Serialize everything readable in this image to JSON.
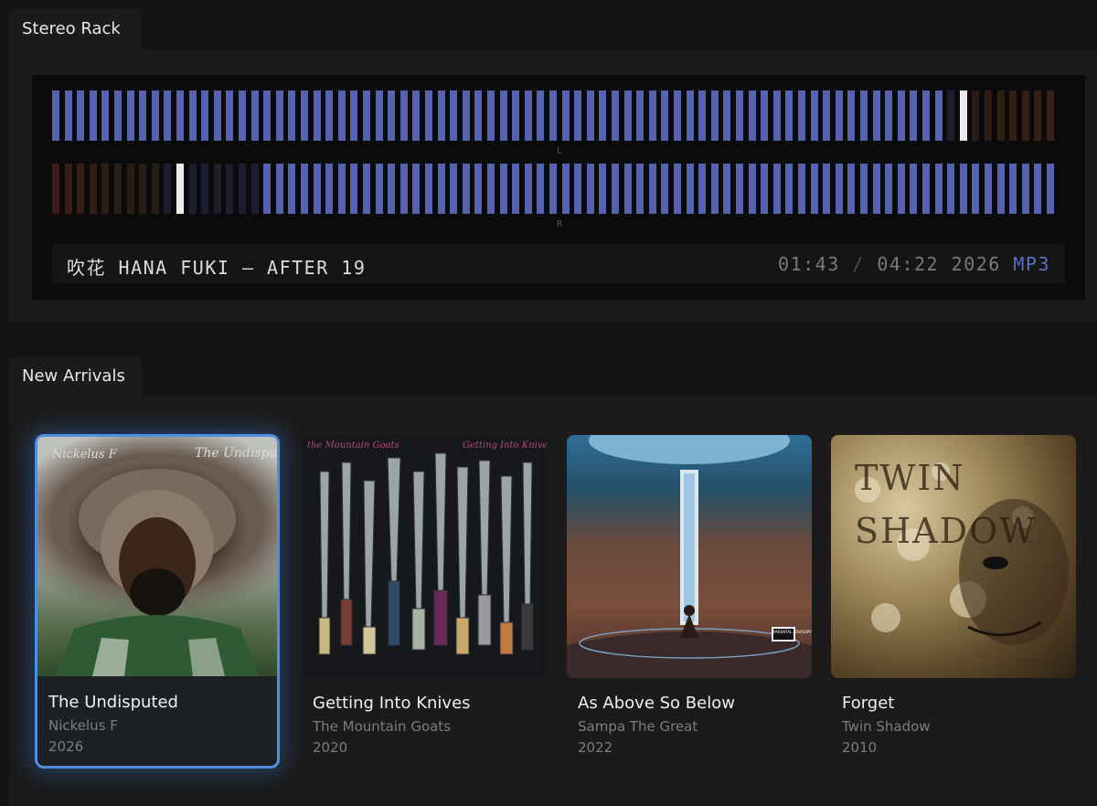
{
  "stereo_rack": {
    "tab_label": "Stereo Rack",
    "left_channel_label": "L",
    "right_channel_label": "R",
    "left_meter": {
      "active_level": 0.885,
      "peak_level": 0.9
    },
    "right_meter": {
      "active_level": 0.79,
      "peak_level": 0.124
    },
    "now_playing": {
      "title": "吹花 HANA FUKI — AFTER 19",
      "elapsed": "01:43",
      "separator": "/",
      "duration": "04:22",
      "year": "2026",
      "format": "MP3"
    },
    "colors": {
      "meter_on": "#5563ae",
      "meter_off": "#1d1f30",
      "peak": "#ececec",
      "hot_off": "#2b1d14"
    }
  },
  "new_arrivals": {
    "tab_label": "New Arrivals",
    "albums": [
      {
        "title": "The Undisputed",
        "artist": "Nickelus F",
        "year": "2026",
        "selected": true,
        "cover_text_left": "Nickelus F",
        "cover_text_right": "The Undisputed"
      },
      {
        "title": "Getting Into Knives",
        "artist": "The Mountain Goats",
        "year": "2020",
        "selected": false,
        "cover_text_left": "the Mountain Goats",
        "cover_text_right": "Getting Into Knives"
      },
      {
        "title": "As Above So Below",
        "artist": "Sampa The Great",
        "year": "2022",
        "selected": false,
        "cover_badge": "PARENTAL ADVISORY"
      },
      {
        "title": "Forget",
        "artist": "Twin Shadow",
        "year": "2010",
        "selected": false,
        "cover_text_big": "TWIN SHADOW"
      }
    ]
  }
}
